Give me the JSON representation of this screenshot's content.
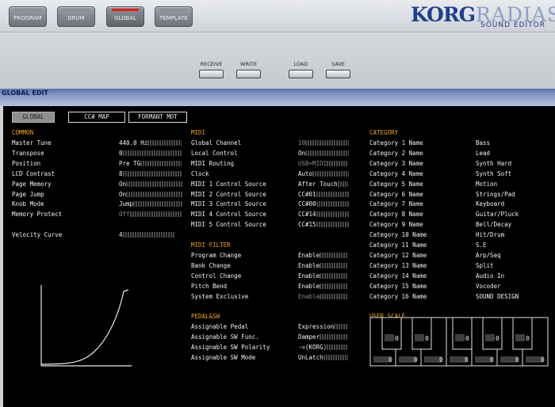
{
  "tabs": [
    {
      "label": "PROGRAM",
      "active": false
    },
    {
      "label": "DRUM",
      "active": false
    },
    {
      "label": "GLOBAL",
      "active": true
    },
    {
      "label": "TEMPLATE",
      "active": false
    }
  ],
  "brand": {
    "korg": "KORG",
    "radias": "RADIAS",
    "sub": "SOUND EDITOR"
  },
  "toolbar": {
    "receive": "RECEIVE",
    "write": "WRITE",
    "load": "LOAD",
    "save": "SAVE"
  },
  "section_title": "GLOBAL EDIT",
  "panel_tabs": [
    {
      "label": "GLOBAL",
      "selected": true
    },
    {
      "label": "CC# MAP",
      "selected": false
    },
    {
      "label": "FORMANT MOT",
      "selected": false
    }
  ],
  "common": {
    "heading": "COMMON",
    "rows": [
      {
        "label": "Master Tune",
        "value": "440.0 Hz",
        "dim": false
      },
      {
        "label": "Transpose",
        "value": "0",
        "dim": false
      },
      {
        "label": "Position",
        "value": "Pre TG",
        "dim": false
      },
      {
        "label": "LCD Contrast",
        "value": "8",
        "dim": false
      },
      {
        "label": "Page Memory",
        "value": "On",
        "dim": false
      },
      {
        "label": "Page Jump",
        "value": "On",
        "dim": false
      },
      {
        "label": "Knob Mode",
        "value": "Jump",
        "dim": false
      },
      {
        "label": "Memory Protect",
        "value": "Off",
        "dim": true
      }
    ],
    "velocity_label": "Velocity Curve",
    "velocity_value": "4"
  },
  "midi": {
    "heading": "MIDI",
    "rows": [
      {
        "label": "Global Channel",
        "value": "10",
        "dim": true
      },
      {
        "label": "Local Control",
        "value": "On",
        "dim": false
      },
      {
        "label": "MIDI Routing",
        "value": "USB+MIDI",
        "dim": true
      },
      {
        "label": "Clock",
        "value": "Auto",
        "dim": false
      },
      {
        "label": "MIDI 1 Control Source",
        "value": "After Touch",
        "dim": false
      },
      {
        "label": "MIDI 2 Control Source",
        "value": "CC#01",
        "dim": false
      },
      {
        "label": "MIDI 3 Control Source",
        "value": "CC#00",
        "dim": false
      },
      {
        "label": "MIDI 4 Control Source",
        "value": "CC#14",
        "dim": false
      },
      {
        "label": "MIDI 5 Control Source",
        "value": "CC#15",
        "dim": false
      }
    ]
  },
  "midi_filter": {
    "heading": "MIDI FILTER",
    "rows": [
      {
        "label": "Program Change",
        "value": "Enable",
        "dim": false
      },
      {
        "label": "Bank Change",
        "value": "Enable",
        "dim": false
      },
      {
        "label": "Control Change",
        "value": "Enable",
        "dim": false
      },
      {
        "label": "Pitch Bend",
        "value": "Enable",
        "dim": false
      },
      {
        "label": "System Exclusive",
        "value": "Enable",
        "dim": true
      }
    ]
  },
  "pedal_sw": {
    "heading": "PEDAL&SW",
    "rows": [
      {
        "label": "Assignable Pedal",
        "value": "Expression",
        "dim": false
      },
      {
        "label": "Assignable SW Func.",
        "value": "Damper",
        "dim": false
      },
      {
        "label": "Assignable SW Polarity",
        "value": "-=(KORG)",
        "dim": false
      },
      {
        "label": "Assignable SW Mode",
        "value": "UnLatch",
        "dim": false
      }
    ]
  },
  "category": {
    "heading": "CATEGORY",
    "rows": [
      {
        "label": "Category 1 Name",
        "value": "Bass"
      },
      {
        "label": "Category 2 Name",
        "value": "Lead"
      },
      {
        "label": "Category 3 Name",
        "value": "Synth Hard"
      },
      {
        "label": "Category 4 Name",
        "value": "Synth Soft"
      },
      {
        "label": "Category 5 Name",
        "value": "Motion"
      },
      {
        "label": "Category 6 Name",
        "value": "Strings/Pad"
      },
      {
        "label": "Category 7 Name",
        "value": "Keyboard"
      },
      {
        "label": "Category 8 Name",
        "value": "Guitar/Pluck"
      },
      {
        "label": "Category 9 Name",
        "value": "Bell/Decay"
      },
      {
        "label": "Category 10 Name",
        "value": "Hit/Drum"
      },
      {
        "label": "Category 11 Name",
        "value": "S.E"
      },
      {
        "label": "Category 12 Name",
        "value": "Arp/Seq"
      },
      {
        "label": "Category 13 Name",
        "value": "Split"
      },
      {
        "label": "Category 14 Name",
        "value": "Audio In"
      },
      {
        "label": "Category 15 Name",
        "value": "Vocoder"
      },
      {
        "label": "Category 16 Name",
        "value": "SOUND DESIGN"
      }
    ]
  },
  "user_scale": {
    "heading": "USER SCALE",
    "black_values": [
      "0",
      "0",
      "0",
      "0",
      "0"
    ],
    "white_values": [
      "0",
      "0",
      "0",
      "0",
      "0",
      "0",
      "0"
    ]
  },
  "colors": {
    "heading": "#f2a516",
    "panel_bg": "#000000",
    "accent": "#e11d1d"
  }
}
